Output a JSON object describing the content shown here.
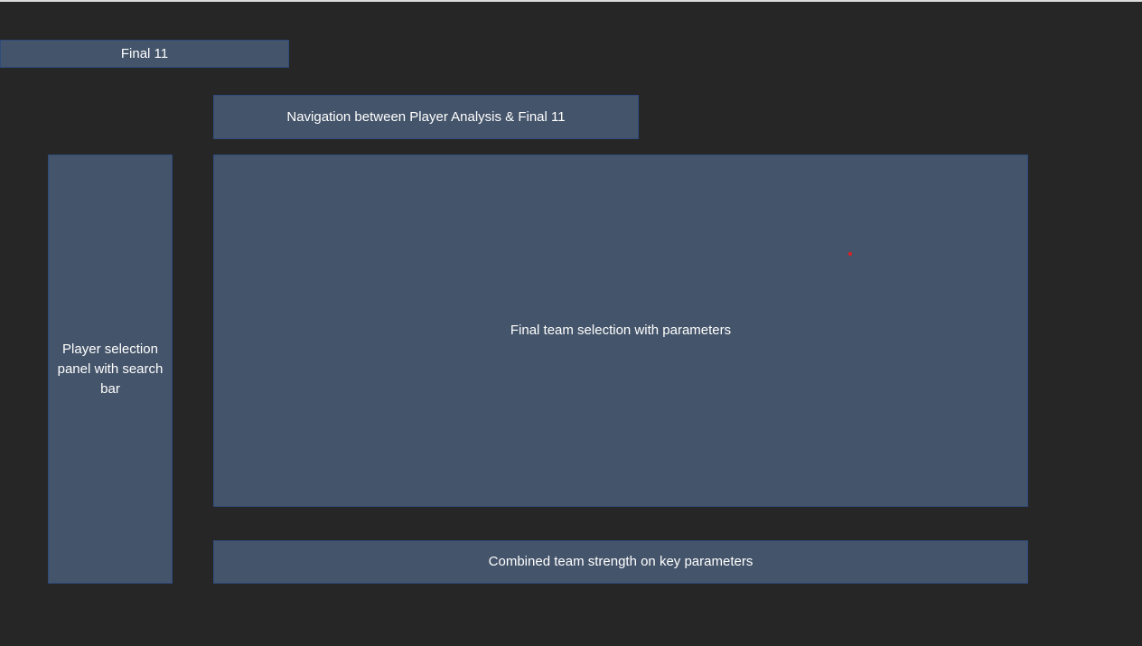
{
  "title_box": {
    "label": "Final 11"
  },
  "navigation_box": {
    "label": "Navigation between Player Analysis & Final 11"
  },
  "player_panel": {
    "label": "Player selection panel with search bar"
  },
  "team_selection_box": {
    "label": "Final team selection with parameters"
  },
  "team_strength_box": {
    "label": "Combined team strength on key parameters"
  },
  "colors": {
    "background": "#262626",
    "box_fill": "#44546a",
    "box_border": "#2f4b7c",
    "text": "#ffffff",
    "marker": "#e02020"
  }
}
